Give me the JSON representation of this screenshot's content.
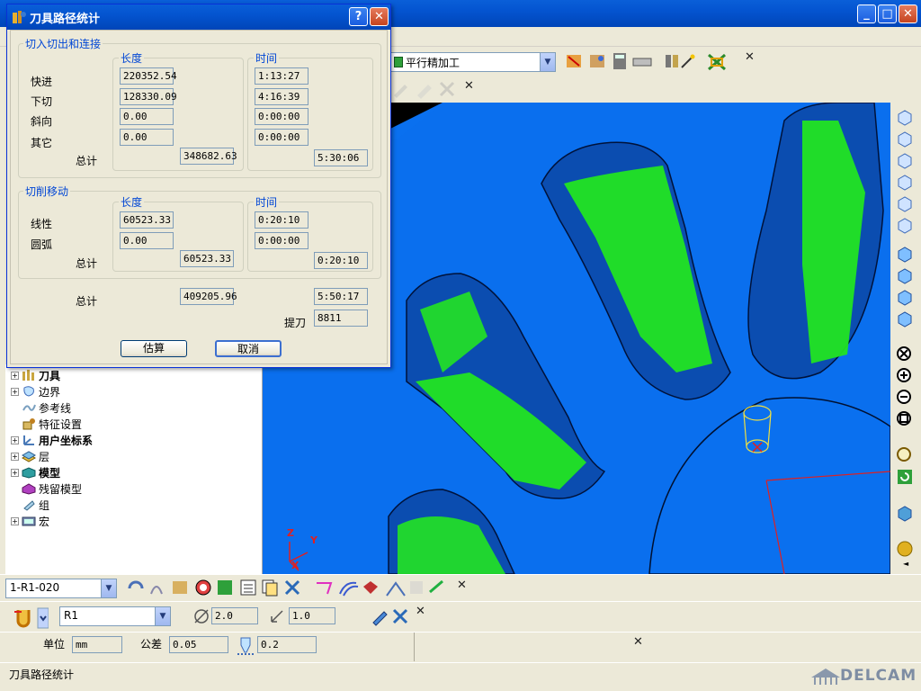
{
  "window": {
    "controls": {
      "minimize": "_",
      "maximize": "□",
      "close": "✕"
    }
  },
  "dialog": {
    "title": "刀具路径统计",
    "help_button": "?",
    "close_button": "✕",
    "section_lead": {
      "title": "切入切出和连接",
      "length_header": "长度",
      "time_header": "时间",
      "rows": [
        {
          "label": "快进",
          "length": "220352.54",
          "time": "1:13:27"
        },
        {
          "label": "下切",
          "length": "128330.09",
          "time": "4:16:39"
        },
        {
          "label": "斜向",
          "length": "0.00",
          "time": "0:00:00"
        },
        {
          "label": "其它",
          "length": "0.00",
          "time": "0:00:00"
        }
      ],
      "total_label": "总计",
      "total_length": "348682.63",
      "total_time": "5:30:06"
    },
    "section_cut": {
      "title": "切削移动",
      "length_header": "长度",
      "time_header": "时间",
      "rows": [
        {
          "label": "线性",
          "length": "60523.33",
          "time": "0:20:10"
        },
        {
          "label": "圆弧",
          "length": "0.00",
          "time": "0:00:00"
        }
      ],
      "total_label": "总计",
      "total_length": "60523.33",
      "total_time": "0:20:10"
    },
    "grand_total_label": "总计",
    "grand_total_length": "409205.96",
    "grand_total_time": "5:50:17",
    "lifts_label": "提刀",
    "lifts_value": "8811",
    "estimate_button": "估算",
    "cancel_button": "取消"
  },
  "toolbar_top": {
    "strategy_select": "平行精加工",
    "close": "✕"
  },
  "toolbar_second": {
    "close": "✕"
  },
  "tree": {
    "items": [
      {
        "label": "刀具",
        "bold": true,
        "expandable": true,
        "icon": "tool-icon"
      },
      {
        "label": "边界",
        "bold": false,
        "expandable": true,
        "icon": "boundary-icon"
      },
      {
        "label": "参考线",
        "bold": false,
        "expandable": false,
        "icon": "pattern-icon"
      },
      {
        "label": "特征设置",
        "bold": false,
        "expandable": false,
        "icon": "feature-icon"
      },
      {
        "label": "用户坐标系",
        "bold": true,
        "expandable": true,
        "icon": "workplane-icon"
      },
      {
        "label": "层",
        "bold": false,
        "expandable": true,
        "icon": "layer-icon"
      },
      {
        "label": "模型",
        "bold": true,
        "expandable": true,
        "icon": "model-icon"
      },
      {
        "label": "残留模型",
        "bold": false,
        "expandable": false,
        "icon": "stock-model-icon"
      },
      {
        "label": "组",
        "bold": false,
        "expandable": false,
        "icon": "group-icon"
      },
      {
        "label": "宏",
        "bold": false,
        "expandable": true,
        "icon": "macro-icon"
      }
    ]
  },
  "viewport": {
    "axis_z": "Z",
    "axis_y": "Y",
    "axis_x": "X"
  },
  "bottom_toolbar1": {
    "toolpath_select": "1-R1-020",
    "close": "✕"
  },
  "bottom_toolbar2": {
    "tool_select": "R1",
    "diameter": "2.0",
    "length": "1.0",
    "close": "✕"
  },
  "bottom_toolbar3": {
    "units_label": "单位",
    "units_value": "mm",
    "tolerance_label": "公差",
    "tolerance_value": "0.05",
    "thickness_value": "0.2",
    "close": "✕"
  },
  "statusbar": {
    "text": "刀具路径统计",
    "brand": "DELCAM"
  },
  "colors": {
    "titlebar": "#0454d0",
    "viewport_bg": "#0a70ef",
    "toolpath": "#00ee00",
    "group_title": "#0046d5"
  }
}
